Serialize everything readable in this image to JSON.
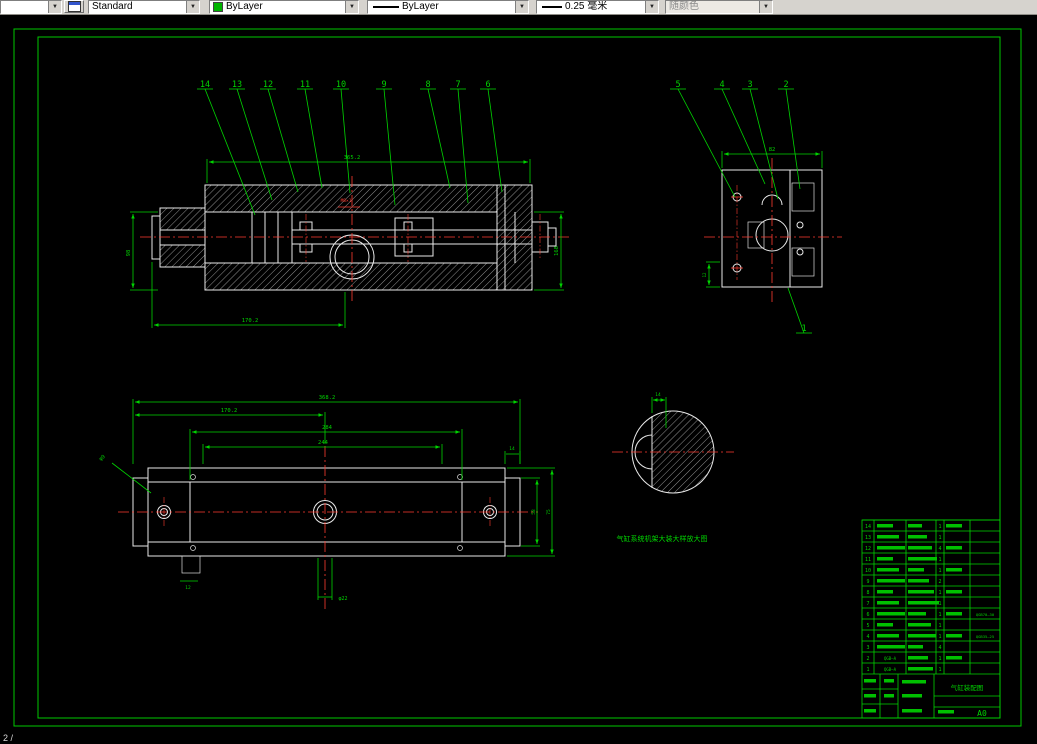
{
  "colors": {
    "frame_green": "#00c800",
    "annotation_green": "#00d400",
    "centerline_red": "#ff3b30",
    "geometry_white": "#e9e9e9",
    "toolbar_bg": "#d6d3ce"
  },
  "toolbar": {
    "style_value": "Standard",
    "color_value": "ByLayer",
    "linetype_value": "ByLayer",
    "lineweight_value": "0.25 毫米",
    "plotstyle_value": "随颜色"
  },
  "status": {
    "text": "2 /"
  },
  "drawing": {
    "callouts_left": [
      "14",
      "13",
      "12",
      "11",
      "10",
      "9",
      "8",
      "7",
      "6"
    ],
    "callouts_right": [
      "5",
      "4",
      "3",
      "2"
    ],
    "callout_one": "1",
    "section_view": {
      "dim_top": "365.2",
      "dim_bottom": "170.2",
      "dim_left": "98",
      "dim_right": "168",
      "red_note": "M8×1"
    },
    "end_view": {
      "dim_top": "82",
      "dim_left": "12"
    },
    "plan_view": {
      "dim_total": "368.2",
      "dim_left": "170.2",
      "dim_inner": "284",
      "dim_inner2": "244",
      "dim_tab": "14",
      "dim_h_inner": "58",
      "dim_h_outer": "75",
      "note_dia": "φ22",
      "note_hole": "φ9",
      "note_small": "12"
    },
    "detail_view": {
      "dim_top": "14",
      "caption": "气缸系统机架大装大样放大图"
    },
    "parts_list": {
      "rows": [
        {
          "no": "14",
          "qty": "1"
        },
        {
          "no": "13",
          "qty": "1"
        },
        {
          "no": "12",
          "qty": "4"
        },
        {
          "no": "11",
          "qty": "1"
        },
        {
          "no": "10",
          "qty": "1"
        },
        {
          "no": "9",
          "qty": "2"
        },
        {
          "no": "8",
          "qty": "1"
        },
        {
          "no": "7",
          "qty": "1"
        },
        {
          "no": "6",
          "qty": "1",
          "remark": "QGB70—30"
        },
        {
          "no": "5",
          "qty": "1"
        },
        {
          "no": "4",
          "qty": "1",
          "remark": "QGB35—25"
        },
        {
          "no": "3",
          "qty": "4"
        },
        {
          "no": "2",
          "qty": "1",
          "code": "QGB—A"
        },
        {
          "no": "1",
          "qty": "1",
          "code": "QGB—A"
        }
      ]
    },
    "title_block": {
      "title": "气缸装配图",
      "sheet": "A0"
    }
  }
}
